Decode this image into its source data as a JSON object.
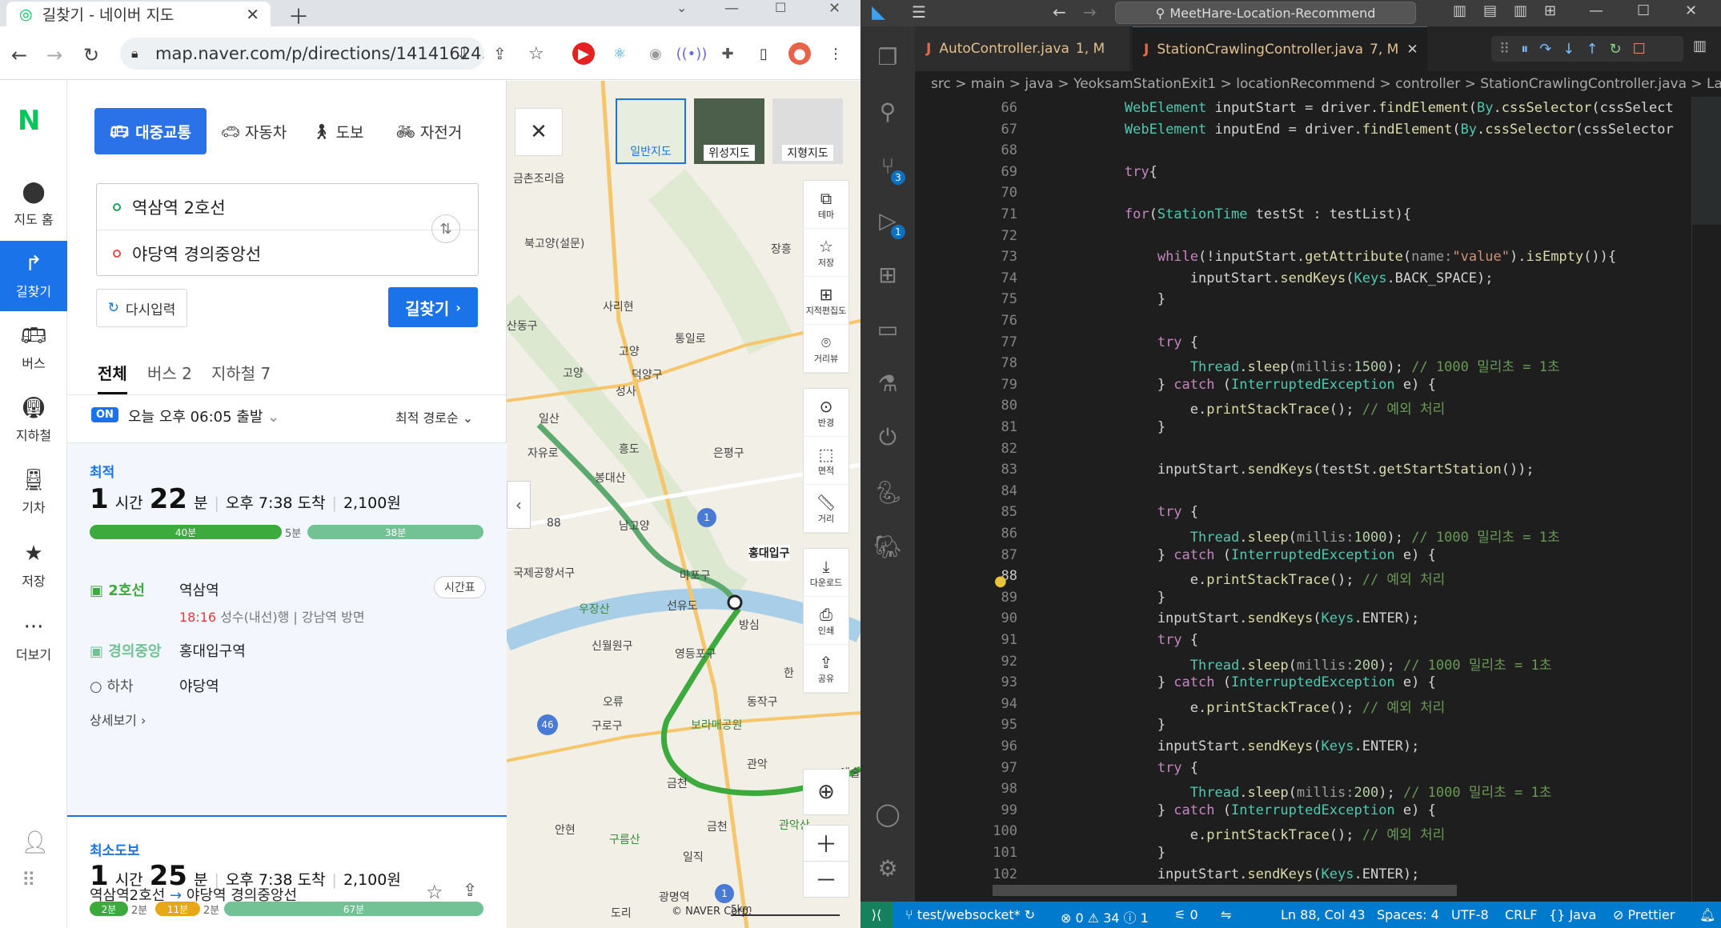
{
  "browser": {
    "tab_title": "길찾기 - 네이버 지도",
    "url": "map.naver.com/p/directions/14141624..."
  },
  "naver": {
    "logo": "N",
    "rail": [
      "지도 홈",
      "길찾기",
      "버스",
      "지하철",
      "기차",
      "저장",
      "더보기"
    ],
    "modes": [
      "대중교통",
      "자동차",
      "도보",
      "자전거"
    ],
    "start": "역삼역 2호선",
    "end": "야당역 경의중앙선",
    "reset_label": "다시입력",
    "search_label": "길찾기",
    "subtabs": [
      "전체",
      "버스 2",
      "지하철 7"
    ],
    "on_badge": "ON",
    "depart": "오늘 오후 06:05 출발",
    "sort": "최적 경로순",
    "route1": {
      "tag": "최적",
      "hours": "1",
      "hour_unit": "시간",
      "mins": "22",
      "min_unit": "분",
      "arrive": "오후 7:38 도착",
      "fare": "2,100원",
      "seg1": "40분",
      "gap": "5분",
      "seg2": "38분",
      "line1": "2호선",
      "station1": "역삼역",
      "timetable": "시간표",
      "time1": "18:16",
      "dir1": "성수(내선)행 | 강남역 방면",
      "line2": "경의중앙",
      "station2": "홍대입구역",
      "off_label": "하차",
      "station3": "야당역",
      "detail": "상세보기"
    },
    "route2": {
      "tag": "최소도보",
      "hours": "1",
      "hour_unit": "시간",
      "mins": "25",
      "min_unit": "분",
      "arrive": "오후 7:38 도착",
      "fare": "2,100원",
      "b1": "2분",
      "g1": "2분",
      "b2": "11분",
      "g2": "2분",
      "b3": "67분"
    },
    "footer_route": "역삼역2호선",
    "footer_route_end": "야당역 경의중앙선"
  },
  "map": {
    "types": [
      "일반지도",
      "위성지도",
      "지형지도"
    ],
    "tools": [
      "테마",
      "저장",
      "지적편집도",
      "거리뷰",
      "반경",
      "면적",
      "거리",
      "다운로드",
      "인쇄",
      "공유"
    ],
    "labels": [
      "금촌조리읍",
      "북고양(설문)",
      "장흥",
      "사리현",
      "산동구",
      "통일로",
      "고양",
      "덕양구",
      "고양",
      "성사",
      "일산",
      "자유로",
      "흥도",
      "은평구",
      "봉대산",
      "88",
      "남고양",
      "홍대입구",
      "국제공항서구",
      "마포구",
      "우장산",
      "선유도",
      "방심",
      "신월원구",
      "영등포구",
      "오류",
      "동작구",
      "구로구",
      "보라매공원",
      "관악",
      "금천",
      "구름산",
      "안현",
      "금천",
      "관악산",
      "일직",
      "광명역",
      "도리",
      "예술",
      "한",
      "46",
      "1",
      "1"
    ],
    "copyright": "© NAVER Corp.",
    "scale": "5km"
  },
  "vscode": {
    "search": "MeetHare-Location-Recommend",
    "tab1": "AutoController.java",
    "tab1_meta": "1, M",
    "tab2": "StationCrawlingController.java",
    "tab2_meta": "7, M",
    "breadcrumb": "src > main > java > YeoksamStationExit1 > locationRecommend > controller > StationCrawlingController.java > Langu",
    "badge_scm": "3",
    "badge_debug": "1",
    "first_line": 66,
    "code": [
      "        WebElement inputStart = driver.findElement(By.cssSelector(cssSelect",
      "        WebElement inputEnd = driver.findElement(By.cssSelector(cssSelector",
      "",
      "        try{",
      "",
      "        for(StationTime testSt : testList){",
      "",
      "            while(!inputStart.getAttribute(name:\"value\").isEmpty()){",
      "                inputStart.sendKeys(Keys.BACK_SPACE);",
      "            }",
      "",
      "            try {",
      "                Thread.sleep(millis:1500); // 1000 밀리초 = 1초",
      "            } catch (InterruptedException e) {",
      "                e.printStackTrace(); // 예외 처리",
      "            }",
      "",
      "            inputStart.sendKeys(testSt.getStartStation());",
      "",
      "            try {",
      "                Thread.sleep(millis:1000); // 1000 밀리초 = 1초",
      "            } catch (InterruptedException e) {",
      "                e.printStackTrace(); // 예외 처리",
      "            }",
      "            inputStart.sendKeys(Keys.ENTER);",
      "            try {",
      "                Thread.sleep(millis:200); // 1000 밀리초 = 1초",
      "            } catch (InterruptedException e) {",
      "                e.printStackTrace(); // 예외 처리",
      "            }",
      "            inputStart.sendKeys(Keys.ENTER);",
      "            try {",
      "                Thread.sleep(millis:200); // 1000 밀리초 = 1초",
      "            } catch (InterruptedException e) {",
      "                e.printStackTrace(); // 예외 처리",
      "            }",
      "            inputStart.sendKeys(Keys.ENTER);"
    ],
    "status": {
      "branch": "test/websocket*",
      "problems": "⊗ 0 ⚠ 34 ⓘ 1",
      "ports": "0",
      "position": "Ln 88, Col 43",
      "spaces": "Spaces: 4",
      "encoding": "UTF-8",
      "eol": "CRLF",
      "language": "{} Java",
      "prettier": "Prettier"
    },
    "colors": {
      "accent": "#007acc",
      "bg": "#1e1e1e"
    }
  }
}
